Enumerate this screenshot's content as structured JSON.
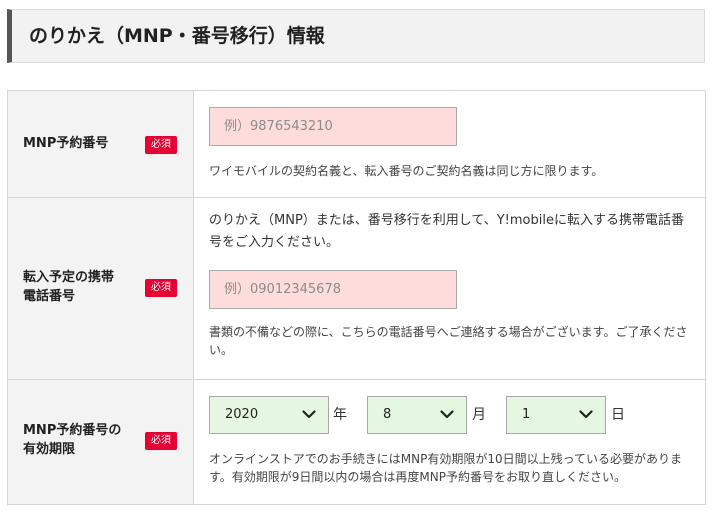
{
  "section": {
    "title": "のりかえ（MNP・番号移行）情報"
  },
  "required_label": "必須",
  "mnp_number": {
    "label": "MNP予約番号",
    "placeholder": "例）9876543210",
    "note": "ワイモバイルの契約名義と、転入番号のご契約名義は同じ方に限ります。"
  },
  "transfer_phone": {
    "label_line1": "転入予定の携帯",
    "label_line2": "電話番号",
    "lead": "のりかえ（MNP）または、番号移行を利用して、Y!mobileに転入する携帯電話番号をご入力ください。",
    "placeholder": "例）09012345678",
    "note": "書類の不備などの際に、こちらの電話番号へご連絡する場合がございます。ご了承ください。"
  },
  "mnp_expiry": {
    "label_line1": "MNP予約番号の",
    "label_line2": "有効期限",
    "year": {
      "value": "2020",
      "unit": "年",
      "icon": "chevron-down-icon"
    },
    "month": {
      "value": "8",
      "unit": "月",
      "icon": "chevron-down-icon"
    },
    "day": {
      "value": "1",
      "unit": "日",
      "icon": "chevron-down-icon"
    },
    "note": "オンラインストアでのお手続きにはMNP有効期限が10日間以上残っている必要があります。有効期限が9日間以内の場合は再度MNP予約番号をお取り直しください。"
  },
  "colors": {
    "required_badge": "#e60033",
    "input_background": "#ffdcdc",
    "select_background": "#e5f6e1",
    "label_background": "#f3f3f3",
    "header_accent": "#555555"
  }
}
